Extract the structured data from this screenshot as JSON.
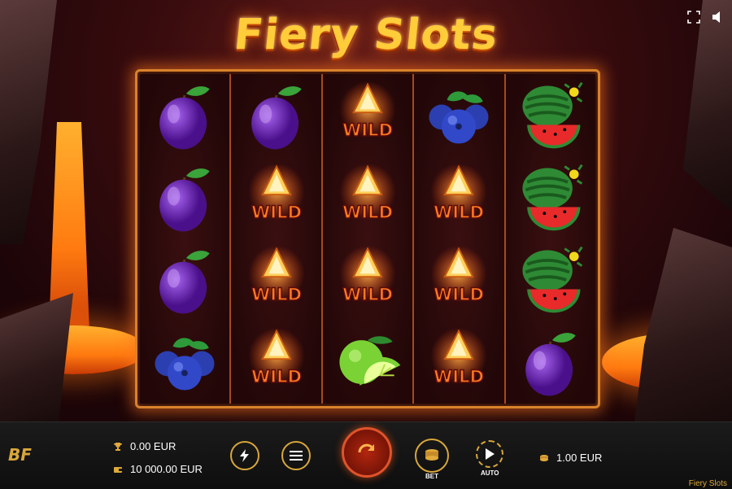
{
  "title": "Fiery Slots",
  "header": {
    "fullscreen_icon": "fullscreen-icon",
    "sound_icon": "speaker-icon"
  },
  "reels": [
    [
      "plum",
      "plum",
      "plum",
      "blueberry"
    ],
    [
      "plum",
      "wild",
      "wild",
      "wild"
    ],
    [
      "wild",
      "wild",
      "wild",
      "lime"
    ],
    [
      "blueberry",
      "wild",
      "wild",
      "wild"
    ],
    [
      "watermelon",
      "watermelon",
      "watermelon",
      "plum"
    ]
  ],
  "wild_label": "WILD",
  "controls": {
    "win_value": "0.00 EUR",
    "balance_value": "10 000.00 EUR",
    "bet_value": "1.00 EUR",
    "bet_label": "BET",
    "auto_label": "AUTO",
    "game_name": "Fiery Slots"
  },
  "colors": {
    "accent": "#d9a73a",
    "frame": "#d9822b"
  }
}
